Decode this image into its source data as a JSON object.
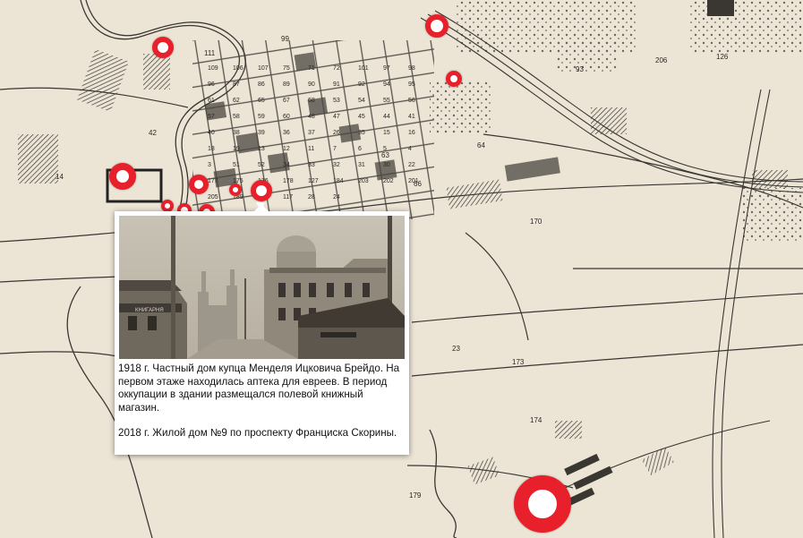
{
  "map": {
    "block_numbers": [
      "111",
      "99",
      "109",
      "106",
      "107",
      "75",
      "71",
      "72",
      "101",
      "97",
      "98",
      "96",
      "87",
      "86",
      "89",
      "90",
      "91",
      "92",
      "93",
      "94",
      "95",
      "61",
      "62",
      "63",
      "64",
      "65",
      "66",
      "67",
      "68",
      "53",
      "54",
      "55",
      "56",
      "57",
      "58",
      "59",
      "60",
      "48",
      "47",
      "45",
      "44",
      "42",
      "41",
      "40",
      "38",
      "39",
      "36",
      "37",
      "26",
      "35",
      "15",
      "16",
      "18",
      "19",
      "14",
      "13",
      "12",
      "11",
      "7",
      "6",
      "5",
      "4",
      "3",
      "51",
      "52",
      "34",
      "33",
      "32",
      "31",
      "30",
      "23",
      "22",
      "177",
      "173",
      "175",
      "174",
      "176",
      "179",
      "178",
      "170",
      "127",
      "126",
      "184",
      "206",
      "203",
      "202",
      "201",
      "205",
      "189",
      "119",
      "117",
      "28",
      "24"
    ]
  },
  "popup": {
    "caption_1918": "1918 г.  Частный дом купца Менделя Ицковича Брейдо. На первом этаже находилась аптека для евреев. В период оккупации в здании размещался полевой книжный магазин.",
    "caption_2018": "2018 г.  Жилой дом №9 по проспекту Франциска Скорины.",
    "photo_signs": [
      "КНИГАРНЯ"
    ]
  },
  "colors": {
    "marker_red": "#e8202b",
    "paper": "#ece5d6",
    "ink": "#3a3733"
  }
}
